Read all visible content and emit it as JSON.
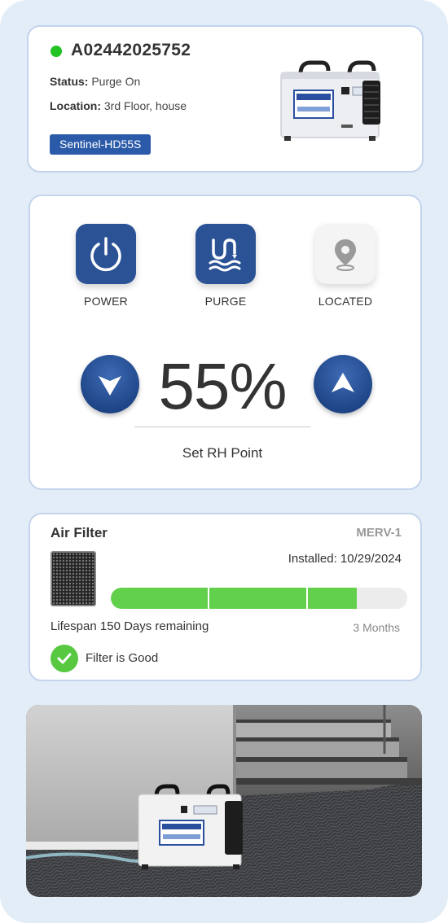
{
  "device": {
    "status_color": "#22c322",
    "serial": "A02442025752",
    "status_label": "Status:",
    "status_value": "Purge On",
    "location_label": "Location:",
    "location_value": "3rd Floor, house",
    "model": "Sentinel-HD55S",
    "image_icon": "dehumidifier-unit"
  },
  "controls": {
    "power": {
      "label": "POWER",
      "icon": "power-icon"
    },
    "purge": {
      "label": "PURGE",
      "icon": "purge-icon"
    },
    "located": {
      "label": "LOCATED",
      "icon": "location-pin-icon"
    }
  },
  "humidity": {
    "value": "55%",
    "label": "Set RH Point",
    "down_icon": "arrow-down-icon",
    "up_icon": "arrow-up-icon"
  },
  "filter": {
    "title": "Air Filter",
    "type": "MERV-1",
    "installed": "Installed: 10/29/2024",
    "lifespan_label": "Lifespan",
    "lifespan_value": "150 Days remaining",
    "period": "3 Months",
    "progress_fraction": 0.83,
    "status": "Filter is Good",
    "accent_color": "#62d04b"
  },
  "photo": {
    "scene": "dehumidifier-on-carpet-photo"
  },
  "colors": {
    "primary": "#2a5295",
    "background": "#e3edf8"
  }
}
